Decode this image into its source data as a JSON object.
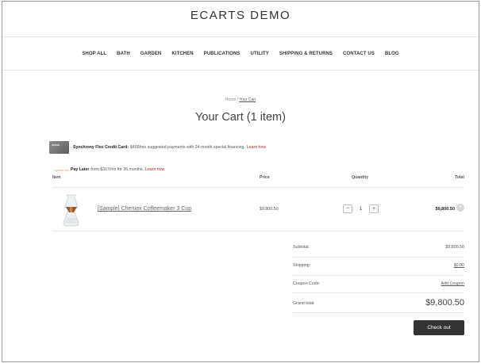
{
  "brand": "ECARTS DEMO",
  "nav": [
    "SHOP ALL",
    "BATH",
    "GARDEN",
    "KITCHEN",
    "PUBLICATIONS",
    "UTILITY",
    "SHIPPING & RETURNS",
    "CONTACT US",
    "BLOG"
  ],
  "breadcrumb": {
    "home": "Home",
    "sep": "/",
    "current": "Your Cart"
  },
  "page_title": "Your Cart (1 item)",
  "synchrony": {
    "bold": "Synchrony Flex Credit Card:",
    "text": "$409/mo suggested payments with 24-month special financing.",
    "link": "Learn how"
  },
  "paylater": {
    "logo": "synchrony",
    "bold": "Pay Later",
    "text": "from $317/mo for 36 months.",
    "link": "Learn how"
  },
  "table": {
    "headers": {
      "item": "Item",
      "price": "Price",
      "quantity": "Quantity",
      "total": "Total"
    },
    "rows": [
      {
        "name": "[Sample] Chemex Coffeemaker 3 Cup",
        "price": "$9,800.50",
        "qty": "1",
        "minus": "−",
        "plus": "+",
        "total": "$9,800.50",
        "remove": "×"
      }
    ]
  },
  "summary": {
    "subtotal_label": "Subtotal:",
    "subtotal": "$9,800.50",
    "shipping_label": "Shipping:",
    "shipping": "$0.00",
    "coupon_label": "Coupon Code:",
    "coupon": "Add Coupon",
    "grand_label": "Grand total:",
    "grand": "$9,800.50"
  },
  "checkout_label": "Check out"
}
